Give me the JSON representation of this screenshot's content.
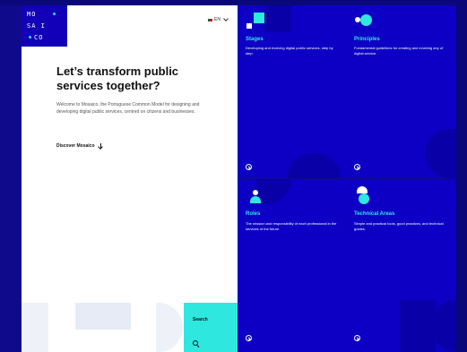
{
  "brand": {
    "logo_row1": "MO",
    "logo_row2": "SA I",
    "logo_row3": "CO"
  },
  "language": {
    "current": "EN"
  },
  "hero": {
    "title": "Let’s transform public services together?",
    "text": "Welcome to Mosaico, the Portuguese Common Model for designing and developing digital public services, centred on citizens and businesses.",
    "cta_label": "Discover Mosaico"
  },
  "search": {
    "label": "Search"
  },
  "cards": [
    {
      "title": "Stages",
      "text": "Developing and evolving digital public services, step by step."
    },
    {
      "title": "Principles",
      "text": "Fundamental guidelines for creating and evolving any of digital service."
    },
    {
      "title": "Roles",
      "text": "The mission and responsibility of each professional in the services of the future."
    },
    {
      "title": "Technical Areas",
      "text": "Simple and practical tools, good practices, and technical guides."
    }
  ],
  "colors": {
    "background": "#0f0a8c",
    "card": "#0d00c4",
    "accent": "#2ee8e0",
    "logo_bg": "#1200b8"
  },
  "icons": [
    "arrow-down-icon",
    "search-icon",
    "arrow-circle-right-icon",
    "flag-icon",
    "chevron-down-icon"
  ]
}
